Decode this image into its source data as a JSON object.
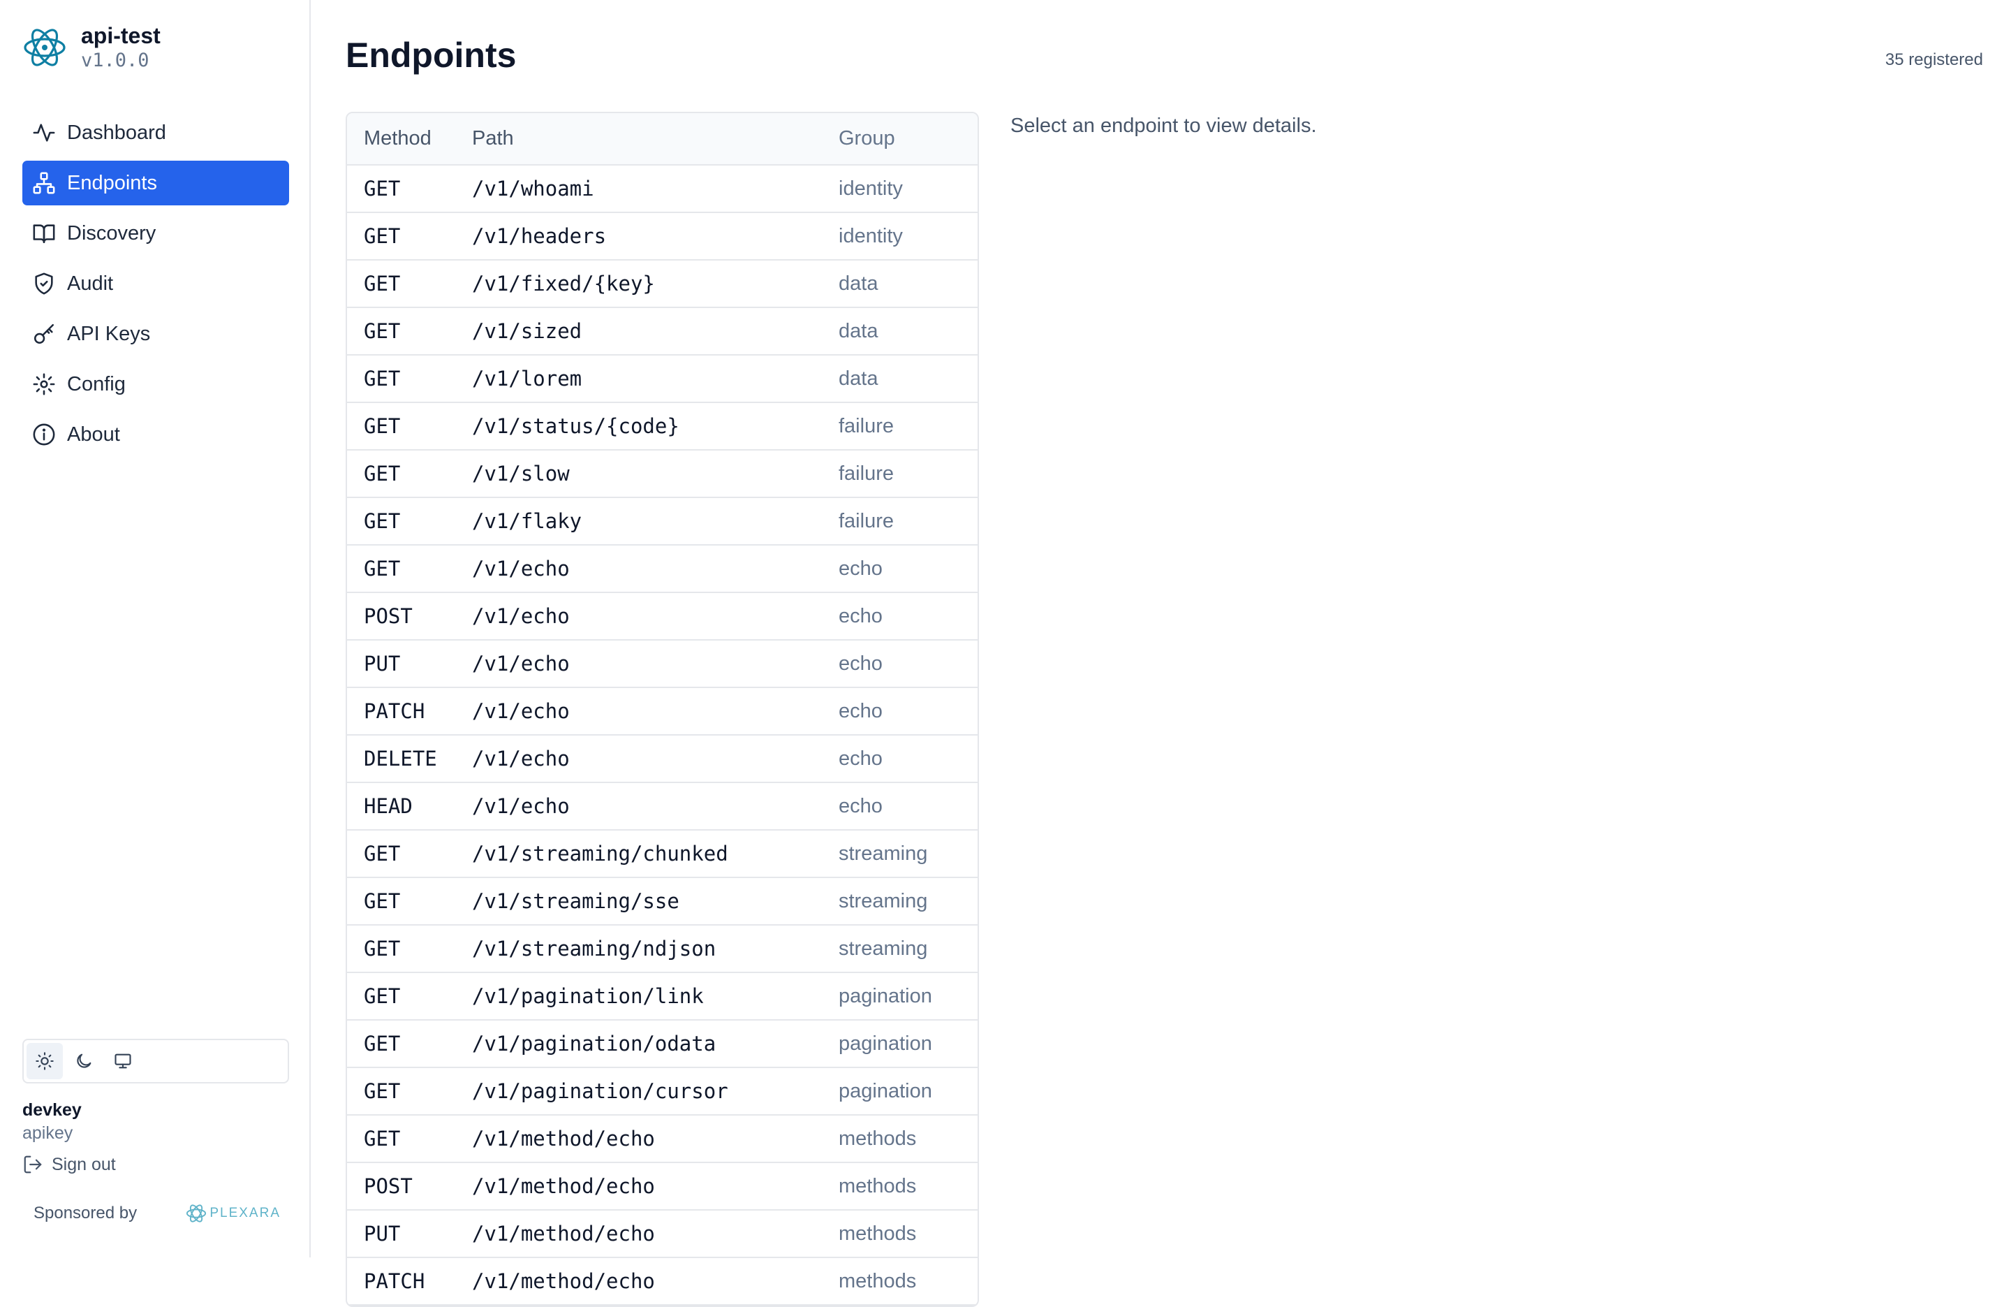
{
  "brand": {
    "name": "api-test",
    "version": "v1.0.0"
  },
  "nav": [
    {
      "label": "Dashboard",
      "icon": "activity-icon",
      "active": false
    },
    {
      "label": "Endpoints",
      "icon": "network-icon",
      "active": true
    },
    {
      "label": "Discovery",
      "icon": "book-icon",
      "active": false
    },
    {
      "label": "Audit",
      "icon": "shield-icon",
      "active": false
    },
    {
      "label": "API Keys",
      "icon": "key-icon",
      "active": false
    },
    {
      "label": "Config",
      "icon": "gear-icon",
      "active": false
    },
    {
      "label": "About",
      "icon": "info-icon",
      "active": false
    }
  ],
  "theme": {
    "options": [
      "light",
      "dark",
      "system"
    ],
    "selected": "light"
  },
  "user": {
    "name": "devkey",
    "type": "apikey",
    "signout_label": "Sign out"
  },
  "sponsor": {
    "label": "Sponsored by",
    "name": "PLEXARA"
  },
  "page": {
    "title": "Endpoints",
    "count": "35 registered",
    "hint": "Select an endpoint to view details."
  },
  "table": {
    "headers": {
      "method": "Method",
      "path": "Path",
      "group": "Group"
    },
    "rows": [
      {
        "method": "GET",
        "path": "/v1/whoami",
        "group": "identity"
      },
      {
        "method": "GET",
        "path": "/v1/headers",
        "group": "identity"
      },
      {
        "method": "GET",
        "path": "/v1/fixed/{key}",
        "group": "data"
      },
      {
        "method": "GET",
        "path": "/v1/sized",
        "group": "data"
      },
      {
        "method": "GET",
        "path": "/v1/lorem",
        "group": "data"
      },
      {
        "method": "GET",
        "path": "/v1/status/{code}",
        "group": "failure"
      },
      {
        "method": "GET",
        "path": "/v1/slow",
        "group": "failure"
      },
      {
        "method": "GET",
        "path": "/v1/flaky",
        "group": "failure"
      },
      {
        "method": "GET",
        "path": "/v1/echo",
        "group": "echo"
      },
      {
        "method": "POST",
        "path": "/v1/echo",
        "group": "echo"
      },
      {
        "method": "PUT",
        "path": "/v1/echo",
        "group": "echo"
      },
      {
        "method": "PATCH",
        "path": "/v1/echo",
        "group": "echo"
      },
      {
        "method": "DELETE",
        "path": "/v1/echo",
        "group": "echo"
      },
      {
        "method": "HEAD",
        "path": "/v1/echo",
        "group": "echo"
      },
      {
        "method": "GET",
        "path": "/v1/streaming/chunked",
        "group": "streaming"
      },
      {
        "method": "GET",
        "path": "/v1/streaming/sse",
        "group": "streaming"
      },
      {
        "method": "GET",
        "path": "/v1/streaming/ndjson",
        "group": "streaming"
      },
      {
        "method": "GET",
        "path": "/v1/pagination/link",
        "group": "pagination"
      },
      {
        "method": "GET",
        "path": "/v1/pagination/odata",
        "group": "pagination"
      },
      {
        "method": "GET",
        "path": "/v1/pagination/cursor",
        "group": "pagination"
      },
      {
        "method": "GET",
        "path": "/v1/method/echo",
        "group": "methods"
      },
      {
        "method": "POST",
        "path": "/v1/method/echo",
        "group": "methods"
      },
      {
        "method": "PUT",
        "path": "/v1/method/echo",
        "group": "methods"
      },
      {
        "method": "PATCH",
        "path": "/v1/method/echo",
        "group": "methods"
      }
    ]
  },
  "colors": {
    "accent": "#2563eb",
    "text": "#0f172a",
    "muted": "#64748b",
    "border": "#e5e7eb",
    "logo": "#0e7fa3"
  }
}
